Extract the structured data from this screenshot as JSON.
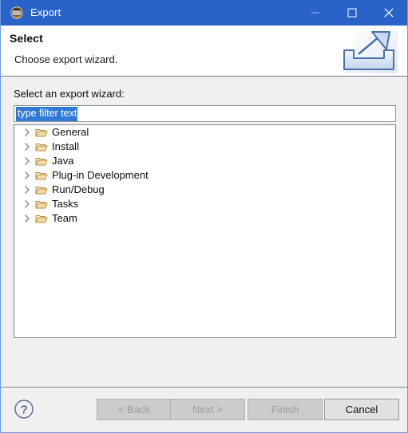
{
  "window": {
    "title": "Export",
    "title_icon": "eclipse-logo-icon",
    "accent_color": "#2a63c8",
    "border_color": "#6f9ae2",
    "controls": [
      {
        "name": "minimize",
        "icon": "minimize-icon",
        "label": "—"
      },
      {
        "name": "maximize",
        "icon": "maximize-icon",
        "label": "□"
      },
      {
        "name": "close",
        "icon": "close-icon",
        "label": "✕"
      }
    ]
  },
  "header": {
    "title": "Select",
    "subtitle": "Choose export wizard.",
    "icon": "export-wizard-banner-icon"
  },
  "body": {
    "wizard_label": "Select an export wizard:",
    "filter": {
      "value": "type filter text",
      "placeholder": "type filter text",
      "selected": true,
      "selection_color": "#2e7ad6"
    },
    "tree": {
      "expander_icon": "chevron-right-icon",
      "node_icon": "folder-icon",
      "items": [
        {
          "label": "General",
          "expanded": false
        },
        {
          "label": "Install",
          "expanded": false
        },
        {
          "label": "Java",
          "expanded": false
        },
        {
          "label": "Plug-in Development",
          "expanded": false
        },
        {
          "label": "Run/Debug",
          "expanded": false
        },
        {
          "label": "Tasks",
          "expanded": false
        },
        {
          "label": "Team",
          "expanded": false
        }
      ]
    }
  },
  "footer": {
    "help_icon": "help-question-icon",
    "buttons": [
      {
        "label": "< Back",
        "enabled": false
      },
      {
        "label": "Next >",
        "enabled": false
      },
      {
        "label": "Finish",
        "enabled": false
      },
      {
        "label": "Cancel",
        "enabled": true
      }
    ]
  }
}
